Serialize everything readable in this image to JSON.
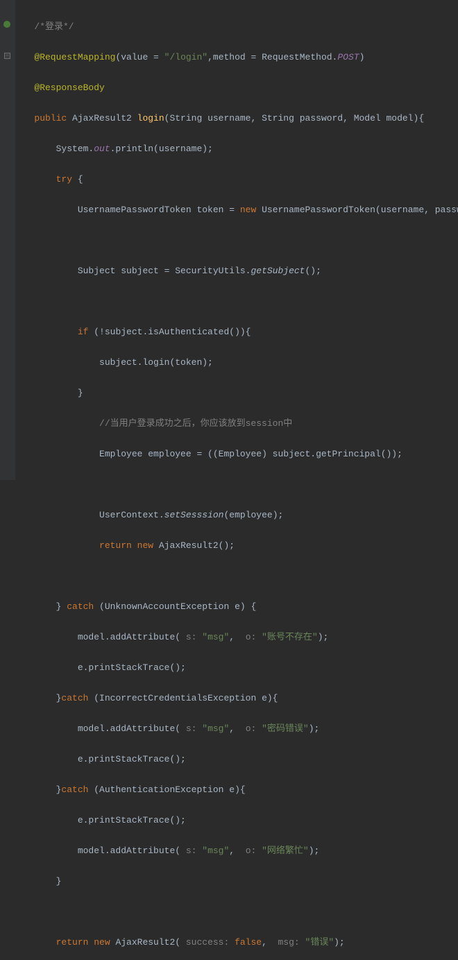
{
  "lines": {
    "l1_comment": "/*登录*/",
    "l2_anno": "@RequestMapping",
    "l2_paren_open": "(",
    "l2_value_key": "value = ",
    "l2_value_str": "\"/login\"",
    "l2_comma": ",",
    "l2_method_key": "method = ",
    "l2_reqmethod": "RequestMethod.",
    "l2_post": "POST",
    "l2_paren_close": ")",
    "l3_anno": "@ResponseBody",
    "l4_public": "public ",
    "l4_type": "AjaxResult2 ",
    "l4_method": "login",
    "l4_params": "(String username, String password, Model model){",
    "l5": "System.",
    "l5_out": "out",
    "l5_println": ".println(username);",
    "l6_try": "try ",
    "l6_brace": "{",
    "l7_type": "UsernamePasswordToken token = ",
    "l7_new": "new ",
    "l7_ctor": "UsernamePasswordToken(username, password);",
    "l8": "Subject subject = SecurityUtils.",
    "l8_getsubject": "getSubject",
    "l8_end": "();",
    "l9_if": "if ",
    "l9_cond": "(!subject.isAuthenticated()){",
    "l10": "subject.login(token);",
    "l11": "}",
    "l12_comment": "//当用户登录成功之后，你应该放到session中",
    "l13": "Employee employee = ((Employee) subject.getPrincipal());",
    "l14": "UserContext.",
    "l14_method": "setSesssion",
    "l14_end": "(employee);",
    "l15_return": "return new ",
    "l15_type": "AjaxResult2();",
    "l16_close": "} ",
    "l16_catch": "catch ",
    "l16_ex": "(UnknownAccountException e) {",
    "l17": "model.addAttribute(",
    "l17_s": " s: ",
    "l17_msg": "\"msg\"",
    "l17_comma": ", ",
    "l17_o": " o: ",
    "l17_val": "\"账号不存在\"",
    "l17_end": ");",
    "l18": "e.printStackTrace();",
    "l19_close": "}",
    "l19_catch": "catch ",
    "l19_ex": "(IncorrectCredentialsException e){",
    "l20": "model.addAttribute(",
    "l20_s": " s: ",
    "l20_msg": "\"msg\"",
    "l20_comma": ", ",
    "l20_o": " o: ",
    "l20_val": "\"密码错误\"",
    "l20_end": ");",
    "l21": "e.printStackTrace();",
    "l22_close": "}",
    "l22_catch": "catch ",
    "l22_ex": "(AuthenticationException e){",
    "l23": "e.printStackTrace();",
    "l24": "model.addAttribute(",
    "l24_s": " s: ",
    "l24_msg": "\"msg\"",
    "l24_comma": ", ",
    "l24_o": " o: ",
    "l24_val": "\"网络繁忙\"",
    "l24_end": ");",
    "l25_close": "}",
    "l26_return": "return new ",
    "l26_type": "AjaxResult2(",
    "l26_success": " success: ",
    "l26_false": "false",
    "l26_comma": ", ",
    "l26_msg": " msg: ",
    "l26_val": "\"错误\"",
    "l26_end": ");"
  }
}
